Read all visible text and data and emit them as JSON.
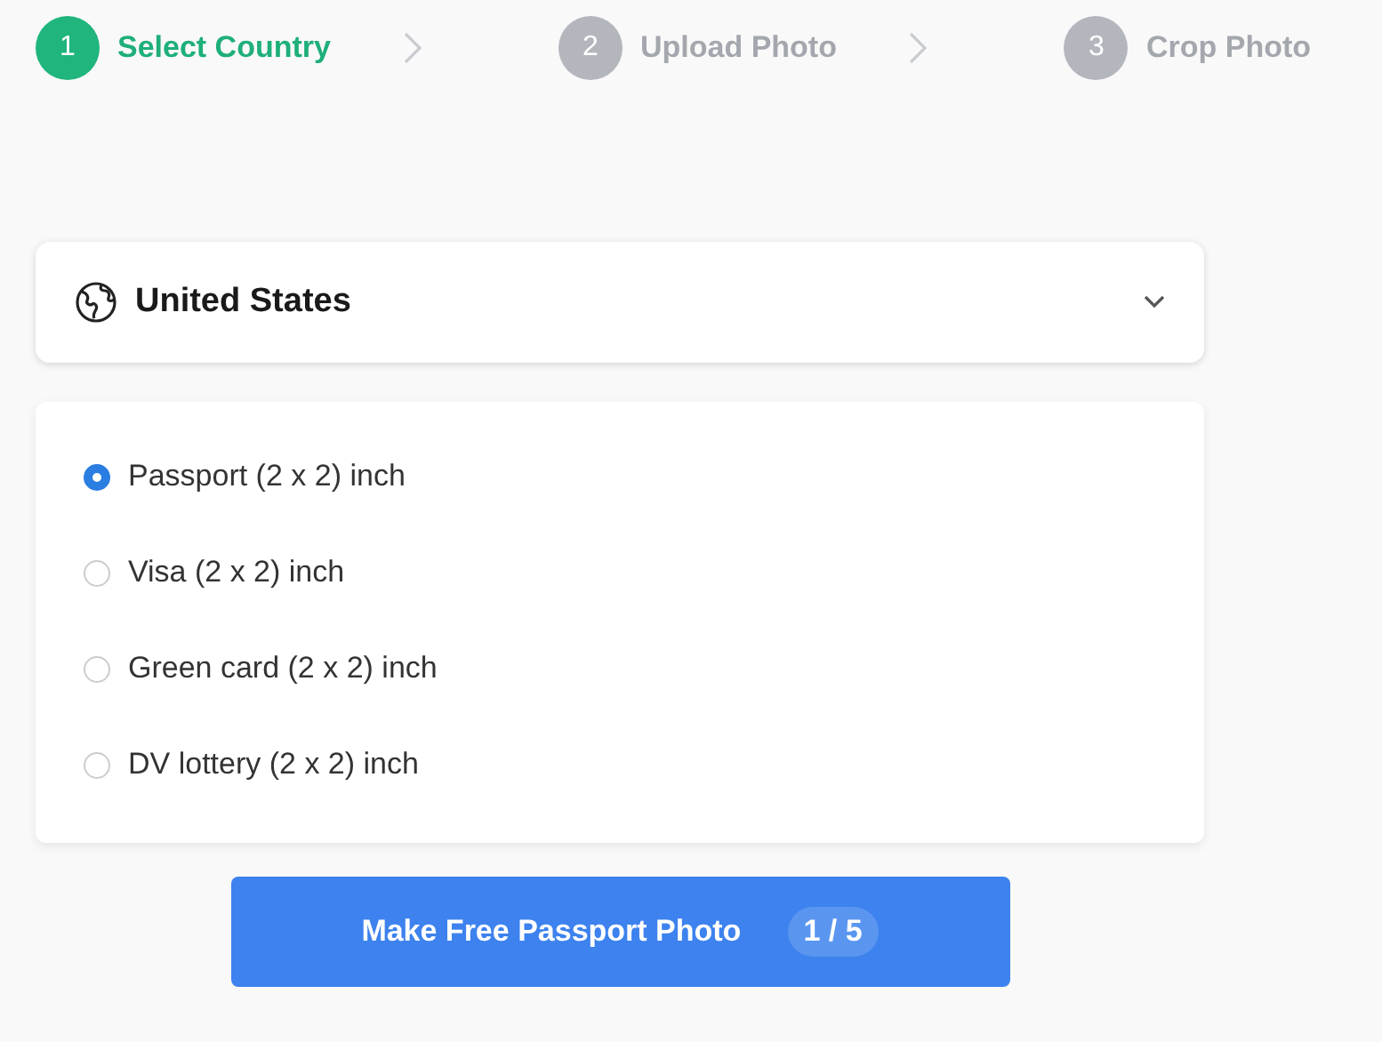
{
  "steps": [
    {
      "number": "1",
      "label": "Select Country",
      "selected": true
    },
    {
      "number": "2",
      "label": "Upload Photo",
      "selected": false
    },
    {
      "number": "3",
      "label": "Crop Photo",
      "selected": false
    }
  ],
  "country": {
    "value": "United States"
  },
  "options": [
    {
      "label": "Passport (2 x 2) inch",
      "selected": true
    },
    {
      "label": "Visa (2 x 2) inch",
      "selected": false
    },
    {
      "label": "Green card (2 x 2) inch",
      "selected": false
    },
    {
      "label": "DV lottery (2 x 2) inch",
      "selected": false
    }
  ],
  "button": {
    "label": "Make Free Passport Photo",
    "count": "1 / 5"
  }
}
